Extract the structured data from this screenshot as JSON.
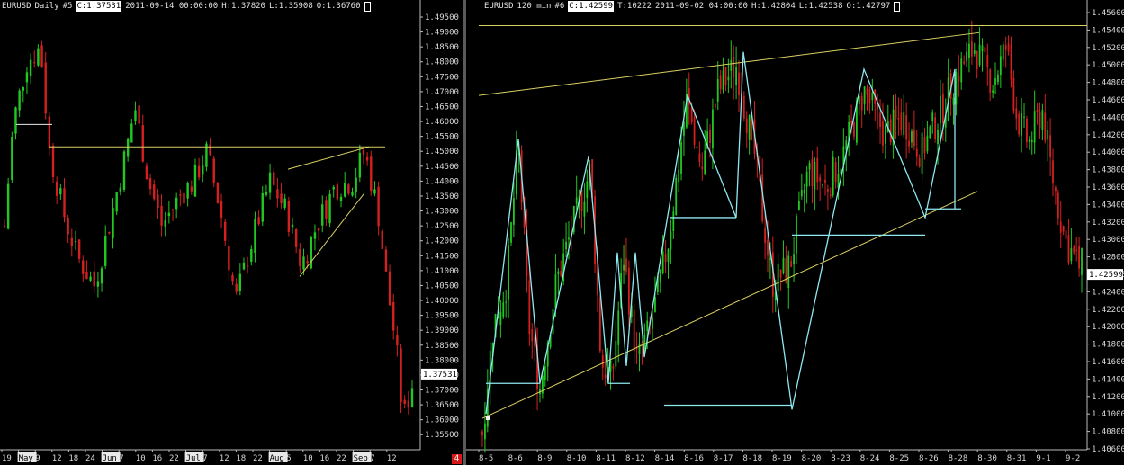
{
  "left_chart": {
    "symbol": "EURUSD",
    "timeframe": "Daily",
    "chart_no": "#5",
    "close_label": "C:1.37531",
    "datetime": "2011-09-14 00:00:00",
    "high_label": "H:1.37820",
    "low_label": "L:1.35908",
    "open_label": "O:1.36760",
    "current_price": "1.37531",
    "price_labels": [
      "1.49500",
      "1.49000",
      "1.48500",
      "1.48000",
      "1.47500",
      "1.47000",
      "1.46500",
      "1.46000",
      "1.45500",
      "1.45000",
      "1.44500",
      "1.44000",
      "1.43500",
      "1.43000",
      "1.42500",
      "1.42000",
      "1.41500",
      "1.41000",
      "1.40500",
      "1.40000",
      "1.39500",
      "1.39000",
      "1.38500",
      "1.38000",
      "1.37500",
      "1.37000",
      "1.36500",
      "1.36000",
      "1.35500"
    ],
    "date_labels": [
      "19",
      "May",
      "9",
      "12",
      "18",
      "24",
      "Jun",
      "7",
      "10",
      "16",
      "22",
      "Jul",
      "7",
      "12",
      "18",
      "22",
      "Aug",
      "5",
      "10",
      "16",
      "22",
      "Sep",
      "7",
      "12"
    ],
    "highlighted_dates": [
      "May",
      "Jun",
      "Jul",
      "Aug",
      "Sep"
    ],
    "badge": "4"
  },
  "right_chart": {
    "symbol": "EURUSD",
    "timeframe": "120 min",
    "chart_no": "#6",
    "close_label": "C:1.42599",
    "ticks_label": "T:10222",
    "datetime": "2011-09-02 04:00:00",
    "high_label": "H:1.42804",
    "low_label": "L:1.42538",
    "open_label": "O:1.42797",
    "current_price": "1.42599",
    "price_labels": [
      "1.45600",
      "1.45400",
      "1.45200",
      "1.45000",
      "1.44800",
      "1.44600",
      "1.44400",
      "1.44200",
      "1.44000",
      "1.43800",
      "1.43600",
      "1.43400",
      "1.43200",
      "1.43000",
      "1.42800",
      "1.42600",
      "1.42400",
      "1.42200",
      "1.42000",
      "1.41800",
      "1.41600",
      "1.41400",
      "1.41200",
      "1.41000",
      "1.40800",
      "1.40600"
    ],
    "date_labels": [
      "8-5",
      "8-6",
      "8-9",
      "8-10",
      "8-11",
      "8-12",
      "8-14",
      "8-16",
      "8-17",
      "8-18",
      "8-19",
      "8-20",
      "8-23",
      "8-24",
      "8-25",
      "8-26",
      "8-28",
      "8-30",
      "8-31",
      "9-1",
      "9-2"
    ]
  },
  "colors": {
    "background": "#000000",
    "bull_candle": "#22c822",
    "bear_candle": "#d42020",
    "trendline": "#d8d060",
    "pattern": "#8ee8f0",
    "axis_text": "#d8d8d8"
  }
}
